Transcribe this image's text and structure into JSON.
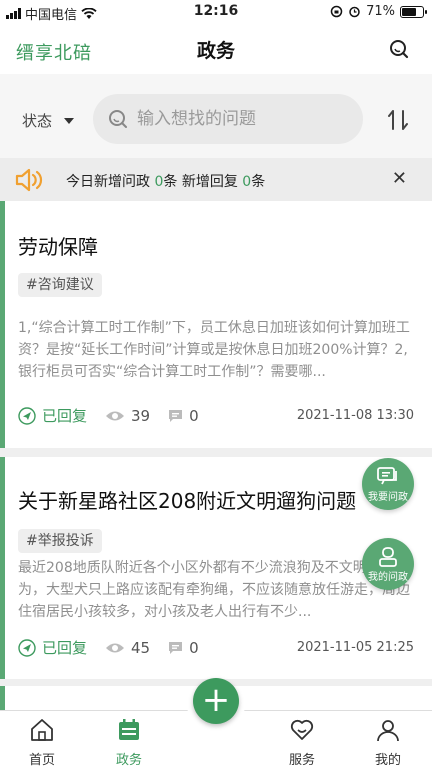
{
  "status_bar": {
    "carrier": "中国电信",
    "time": "12:16",
    "battery": "71%",
    "battery_level": 0.71
  },
  "header": {
    "logo": "缙享北碚",
    "title": "政务"
  },
  "filter": {
    "status_label": "状态",
    "search_placeholder": "输入想找的问题"
  },
  "notice": {
    "prefix": "今日新增问政 ",
    "new_questions": "0",
    "mid": "条 新增回复 ",
    "new_replies": "0",
    "suffix": "条"
  },
  "cards": [
    {
      "title": "劳动保障",
      "tag": "#咨询建议",
      "excerpt": "1,“综合计算工时工作制”下，员工休息日加班该如何计算加班工资？是按“延长工作时间”计算或是按休息日加班200%计算？2,银行柜员可否实“综合计算工时工作制”？需要哪...",
      "status": "已回复",
      "views": "39",
      "comments": "0",
      "date": "2021-11-08 13:30"
    },
    {
      "title": "关于新星路社区208附近文明遛狗问题",
      "tag": "#举报投诉",
      "excerpt": "最近208地质队附近各个小区外都有不少流浪狗及不文明遛狗行为，大型犬只上路应该配有牵狗绳，不应该随意放任游走，周边住宿居民小孩较多，对小孩及老人出行有不少...",
      "status": "已回复",
      "views": "45",
      "comments": "0",
      "date": "2021-11-05 21:25"
    }
  ],
  "fabs": {
    "ask": "我要问政",
    "mine": "我的问政"
  },
  "add_button": "+",
  "add_caption": "",
  "tabs": {
    "home": "首页",
    "gov": "政务",
    "service": "服务",
    "mine": "我的"
  },
  "colors": {
    "accent": "#3d9a5e",
    "notice_icon": "#f0a030"
  }
}
